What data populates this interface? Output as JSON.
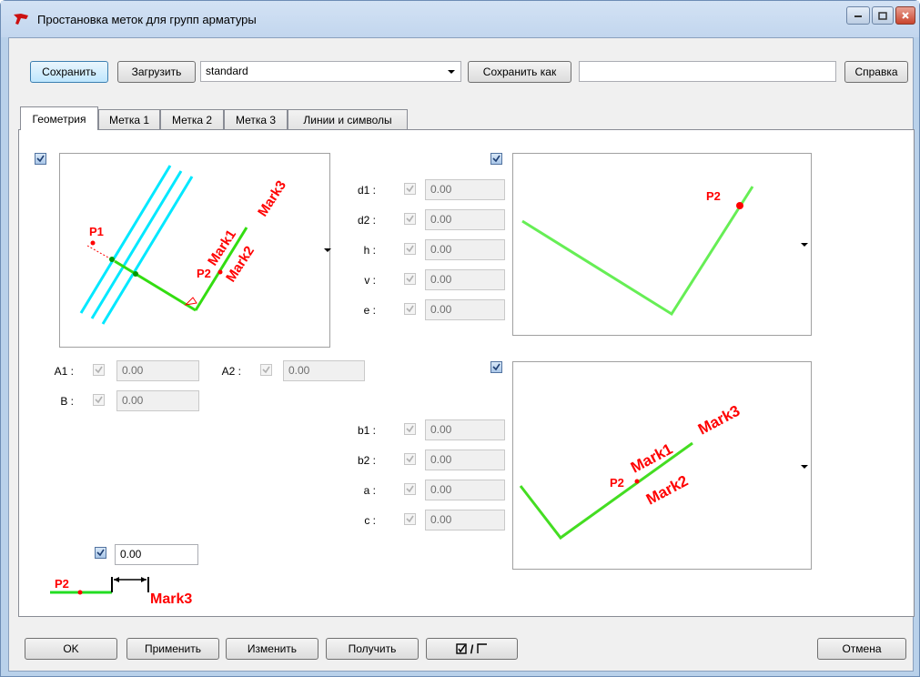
{
  "window": {
    "title": "Простановка меток для групп арматуры"
  },
  "toolbar": {
    "save": "Сохранить",
    "load": "Загрузить",
    "preset_value": "standard",
    "save_as": "Сохранить как",
    "save_as_name": "",
    "help": "Справка"
  },
  "tabs": [
    "Геометрия",
    "Метка 1",
    "Метка 2",
    "Метка 3",
    "Линии и символы"
  ],
  "params_top": [
    {
      "label": "d1 :",
      "value": "0.00"
    },
    {
      "label": "d2 :",
      "value": "0.00"
    },
    {
      "label": "h :",
      "value": "0.00"
    },
    {
      "label": "v :",
      "value": "0.00"
    },
    {
      "label": "e :",
      "value": "0.00"
    }
  ],
  "params_bottom": [
    {
      "label": "b1 :",
      "value": "0.00"
    },
    {
      "label": "b2 :",
      "value": "0.00"
    },
    {
      "label": "a :",
      "value": "0.00"
    },
    {
      "label": "c :",
      "value": "0.00"
    }
  ],
  "params_left": {
    "a1": {
      "label": "A1 :",
      "value": "0.00"
    },
    "a2": {
      "label": "A2 :",
      "value": "0.00"
    },
    "b": {
      "label": "B :",
      "value": "0.00"
    }
  },
  "offset": {
    "value": "0.00"
  },
  "diagram_labels": {
    "p1": "P1",
    "p2": "P2",
    "mark1": "Mark1",
    "mark2": "Mark2",
    "mark3": "Mark3"
  },
  "footer": {
    "ok": "OK",
    "apply": "Применить",
    "change": "Изменить",
    "get": "Получить",
    "toggle": "/",
    "cancel": "Отмена"
  },
  "colors": {
    "rebar": "#00ffff",
    "line": "#00cc00",
    "label": "#ff0000"
  }
}
